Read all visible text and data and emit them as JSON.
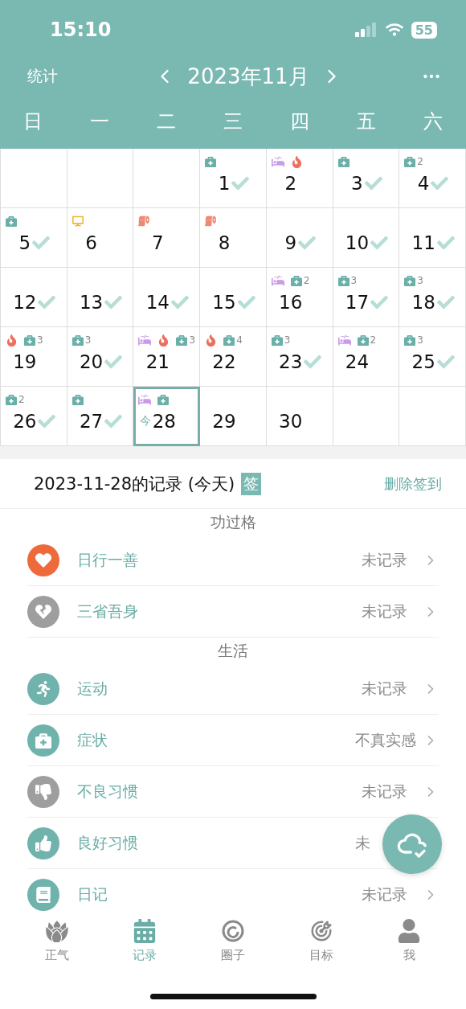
{
  "status_bar": {
    "time": "15:10",
    "battery": "55"
  },
  "header": {
    "left": "统计",
    "title": "2023年11月"
  },
  "weekdays": [
    "日",
    "一",
    "二",
    "三",
    "四",
    "五",
    "六"
  ],
  "calendar": {
    "cells": [
      {
        "kind": "empty"
      },
      {
        "kind": "empty"
      },
      {
        "kind": "empty"
      },
      {
        "kind": "day",
        "day": "1",
        "checked": true,
        "selected": false,
        "markers": [
          {
            "kind": "kit"
          }
        ]
      },
      {
        "kind": "day",
        "day": "2",
        "checked": false,
        "selected": false,
        "markers": [
          {
            "kind": "bed"
          },
          {
            "kind": "fire"
          }
        ]
      },
      {
        "kind": "day",
        "day": "3",
        "checked": true,
        "selected": false,
        "markers": [
          {
            "kind": "kit"
          }
        ]
      },
      {
        "kind": "day",
        "day": "4",
        "checked": true,
        "selected": false,
        "markers": [
          {
            "kind": "kit",
            "count": "2"
          }
        ]
      },
      {
        "kind": "day",
        "day": "5",
        "checked": true,
        "selected": false,
        "markers": [
          {
            "kind": "kit"
          }
        ]
      },
      {
        "kind": "day",
        "day": "6",
        "checked": false,
        "selected": false,
        "markers": [
          {
            "kind": "screen"
          }
        ]
      },
      {
        "kind": "day",
        "day": "7",
        "checked": false,
        "selected": false,
        "markers": [
          {
            "kind": "roll"
          }
        ]
      },
      {
        "kind": "day",
        "day": "8",
        "checked": false,
        "selected": false,
        "markers": [
          {
            "kind": "roll"
          }
        ]
      },
      {
        "kind": "day",
        "day": "9",
        "checked": true,
        "selected": false
      },
      {
        "kind": "day",
        "day": "10",
        "checked": true,
        "selected": false
      },
      {
        "kind": "day",
        "day": "11",
        "checked": true,
        "selected": false
      },
      {
        "kind": "day",
        "day": "12",
        "checked": true,
        "selected": false
      },
      {
        "kind": "day",
        "day": "13",
        "checked": true,
        "selected": false
      },
      {
        "kind": "day",
        "day": "14",
        "checked": true,
        "selected": false
      },
      {
        "kind": "day",
        "day": "15",
        "checked": true,
        "selected": false
      },
      {
        "kind": "day",
        "day": "16",
        "checked": false,
        "selected": false,
        "markers": [
          {
            "kind": "bed"
          },
          {
            "kind": "kit",
            "count": "2"
          }
        ]
      },
      {
        "kind": "day",
        "day": "17",
        "checked": true,
        "selected": false,
        "markers": [
          {
            "kind": "kit",
            "count": "3"
          }
        ]
      },
      {
        "kind": "day",
        "day": "18",
        "checked": true,
        "selected": false,
        "markers": [
          {
            "kind": "kit",
            "count": "3"
          }
        ]
      },
      {
        "kind": "day",
        "day": "19",
        "checked": false,
        "selected": false,
        "markers": [
          {
            "kind": "fire"
          },
          {
            "kind": "kit",
            "count": "3"
          }
        ]
      },
      {
        "kind": "day",
        "day": "20",
        "checked": true,
        "selected": false,
        "markers": [
          {
            "kind": "kit",
            "count": "3"
          }
        ]
      },
      {
        "kind": "day",
        "day": "21",
        "checked": false,
        "selected": false,
        "markers": [
          {
            "kind": "bed"
          },
          {
            "kind": "fire"
          },
          {
            "kind": "kit",
            "count": "3"
          }
        ]
      },
      {
        "kind": "day",
        "day": "22",
        "checked": false,
        "selected": false,
        "markers": [
          {
            "kind": "fire"
          },
          {
            "kind": "kit",
            "count": "4"
          }
        ]
      },
      {
        "kind": "day",
        "day": "23",
        "checked": true,
        "selected": false,
        "markers": [
          {
            "kind": "kit",
            "count": "3"
          }
        ]
      },
      {
        "kind": "day",
        "day": "24",
        "checked": false,
        "selected": false,
        "markers": [
          {
            "kind": "bed"
          },
          {
            "kind": "kit",
            "count": "2"
          }
        ]
      },
      {
        "kind": "day",
        "day": "25",
        "checked": true,
        "selected": false,
        "markers": [
          {
            "kind": "kit",
            "count": "3"
          }
        ]
      },
      {
        "kind": "day",
        "day": "26",
        "checked": true,
        "selected": false,
        "markers": [
          {
            "kind": "kit",
            "count": "2"
          }
        ]
      },
      {
        "kind": "day",
        "day": "27",
        "checked": true,
        "selected": false,
        "markers": [
          {
            "kind": "kit"
          }
        ]
      },
      {
        "kind": "day",
        "day": "28",
        "checked": false,
        "selected": true,
        "today": "今",
        "markers": [
          {
            "kind": "bed"
          },
          {
            "kind": "kit"
          }
        ]
      },
      {
        "kind": "day",
        "day": "29",
        "checked": false,
        "selected": false
      },
      {
        "kind": "day",
        "day": "30",
        "checked": false,
        "selected": false
      },
      {
        "kind": "empty"
      },
      {
        "kind": "empty"
      }
    ]
  },
  "record": {
    "title": "2023-11-28的记录 (今天)",
    "badge": "签",
    "action": "删除签到"
  },
  "sections": [
    {
      "title": "功过格",
      "items": [
        {
          "kind": "heart",
          "color": "#ee6a3a",
          "label": "日行一善",
          "value": "未记录",
          "chevron": true
        },
        {
          "kind": "broken-heart",
          "color": "#9e9e9e",
          "label": "三省吾身",
          "value": "未记录",
          "chevron": true
        }
      ]
    },
    {
      "title": "生活",
      "items": [
        {
          "kind": "runner",
          "color": "#6fb3ac",
          "label": "运动",
          "value": "未记录",
          "chevron": true
        },
        {
          "kind": "kit",
          "color": "#6fb3ac",
          "label": "症状",
          "value": "不真实感",
          "chevron": true
        },
        {
          "kind": "thumbs-down",
          "color": "#9e9e9e",
          "label": "不良习惯",
          "value": "未记录",
          "chevron": true
        },
        {
          "kind": "thumbs-up",
          "color": "#6fb3ac",
          "label": "良好习惯",
          "value": "未",
          "chevron": false
        },
        {
          "kind": "book",
          "color": "#6fb3ac",
          "label": "日记",
          "value": "未记录",
          "chevron": true
        }
      ]
    }
  ],
  "tabs": [
    {
      "label": "正气",
      "selected": false
    },
    {
      "label": "记录",
      "selected": true
    },
    {
      "label": "圈子",
      "selected": false
    },
    {
      "label": "目标",
      "selected": false
    },
    {
      "label": "我",
      "selected": false
    }
  ]
}
